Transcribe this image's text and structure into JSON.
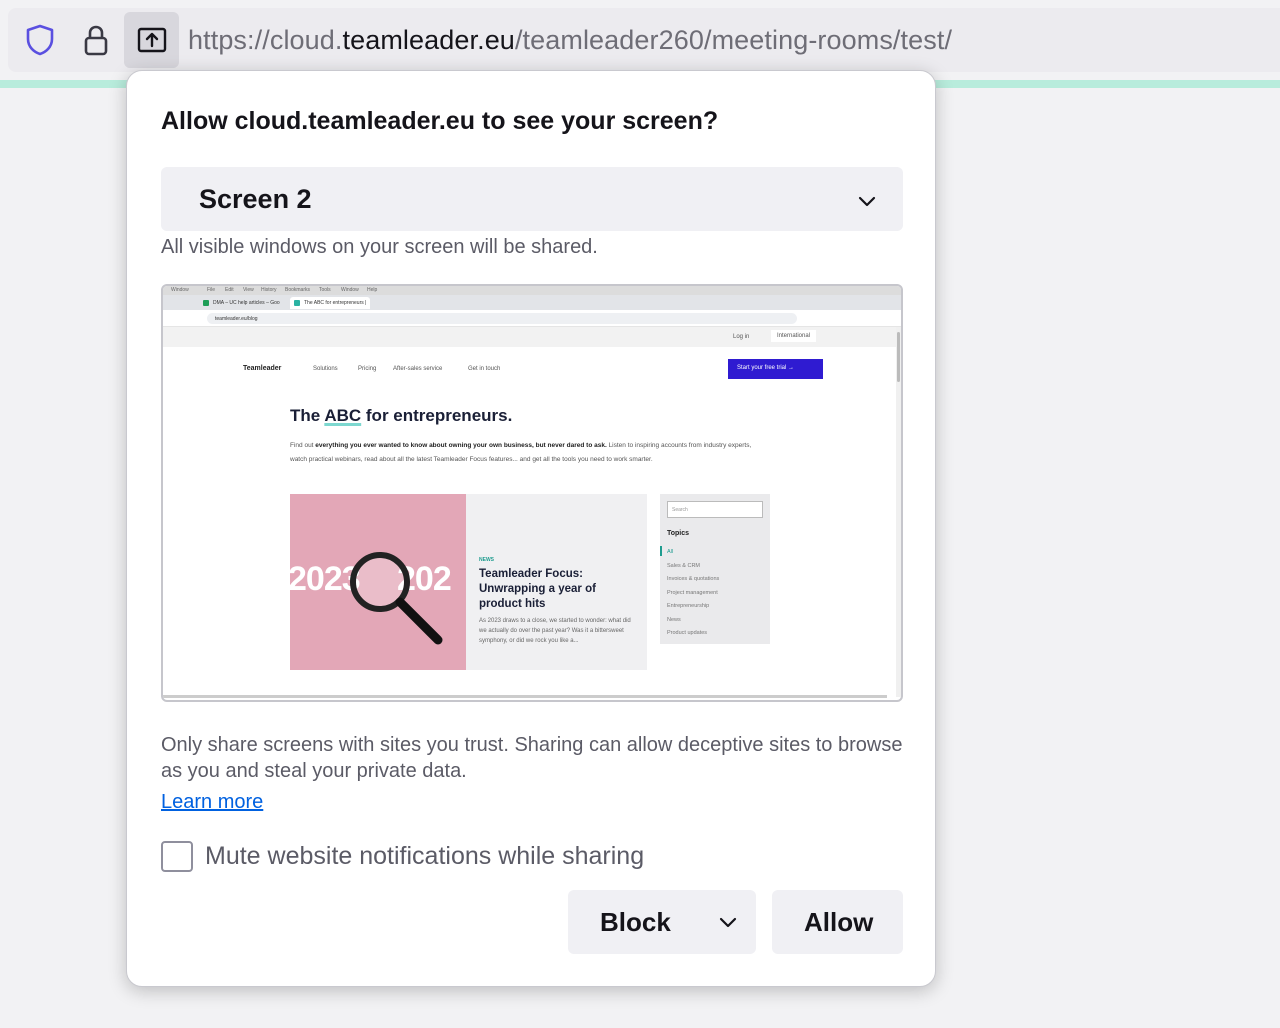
{
  "urlbar": {
    "url_prefix": "https://cloud.",
    "url_host": "teamleader.eu",
    "url_path": "/teamleader260/meeting-rooms/test/"
  },
  "panel": {
    "title": "Allow cloud.teamleader.eu to see your screen?",
    "screen_select": {
      "selected": "Screen 2"
    },
    "shared_note": "All visible windows on your screen will be shared.",
    "warning": "Only share screens with sites you trust. Sharing can allow deceptive sites to browse as you and steal your private data.",
    "learn_more": "Learn more",
    "mute_label": "Mute website notifications while sharing",
    "mute_checked": false,
    "block_label": "Block",
    "allow_label": "Allow"
  },
  "preview": {
    "menubar": [
      "Window",
      "File",
      "Edit",
      "View",
      "History",
      "Bookmarks",
      "Tools",
      "Window",
      "Help"
    ],
    "tabs": [
      "DMA – UC help articles – Goo",
      "The ABC for entrepreneurs |"
    ],
    "address": "teamleader.eu/blog",
    "login": "Log in",
    "international": "International",
    "logo": "Teamleader",
    "nav": [
      "Solutions",
      "Pricing",
      "After-sales service",
      "Get in touch"
    ],
    "cta": "Start your free trial",
    "heading_pre": "The ",
    "heading_hl": "ABC",
    "heading_post": " for entrepreneurs.",
    "desc_pre": "Find out ",
    "desc_bold": "everything you ever wanted to know about owning your own business, but never dared to ask.",
    "desc_post": " Listen to inspiring accounts from industry experts, watch practical webinars, read about all the latest Teamleader Focus features... and get all the tools you need to work smarter.",
    "card": {
      "year_a": "2023",
      "year_b": "202",
      "tag": "NEWS",
      "title": "Teamleader Focus: Unwrapping a year of product hits",
      "text": "As 2023 draws to a close, we started to wonder: what did we actually do over the past year? Was it a bittersweet symphony, or did we rock you like a..."
    },
    "sidebar": {
      "search_placeholder": "Search",
      "topics_title": "Topics",
      "topics": [
        "All",
        "Sales & CRM",
        "Invoices & quotations",
        "Project management",
        "Entrepreneurship",
        "News",
        "Product updates"
      ]
    }
  },
  "colors": {
    "accent_teal": "#b8ecdc",
    "link": "#0061e0",
    "cta": "#2f1bd1"
  },
  "icons": {
    "shield": "shield-icon",
    "lock": "lock-icon",
    "share": "screen-share-icon",
    "chevron": "chevron-down-icon"
  }
}
